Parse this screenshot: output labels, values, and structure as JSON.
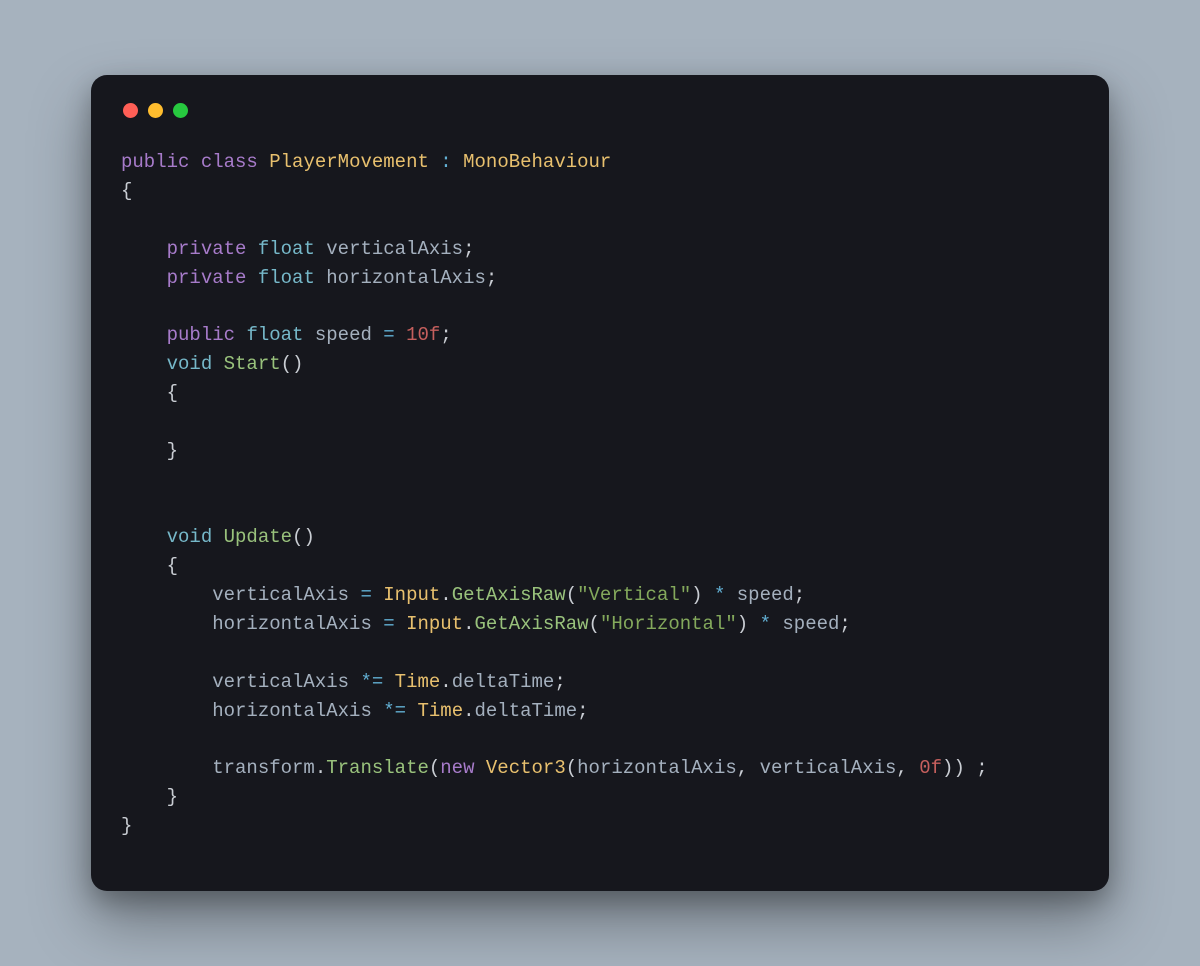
{
  "window": {
    "buttons": [
      "close",
      "minimize",
      "zoom"
    ]
  },
  "code": {
    "lines": [
      [
        {
          "cls": "tok-kw",
          "t": "public"
        },
        {
          "cls": "tok-punc",
          "t": " "
        },
        {
          "cls": "tok-kw",
          "t": "class"
        },
        {
          "cls": "tok-punc",
          "t": " "
        },
        {
          "cls": "tok-class",
          "t": "PlayerMovement"
        },
        {
          "cls": "tok-punc",
          "t": " "
        },
        {
          "cls": "tok-op",
          "t": ":"
        },
        {
          "cls": "tok-punc",
          "t": " "
        },
        {
          "cls": "tok-class",
          "t": "MonoBehaviour"
        }
      ],
      [
        {
          "cls": "tok-punc",
          "t": "{"
        }
      ],
      [
        {
          "cls": "tok-punc",
          "t": ""
        }
      ],
      [
        {
          "cls": "tok-punc",
          "t": "    "
        },
        {
          "cls": "tok-kw",
          "t": "private"
        },
        {
          "cls": "tok-punc",
          "t": " "
        },
        {
          "cls": "tok-type",
          "t": "float"
        },
        {
          "cls": "tok-punc",
          "t": " "
        },
        {
          "cls": "tok-field",
          "t": "verticalAxis"
        },
        {
          "cls": "tok-punc",
          "t": ";"
        }
      ],
      [
        {
          "cls": "tok-punc",
          "t": "    "
        },
        {
          "cls": "tok-kw",
          "t": "private"
        },
        {
          "cls": "tok-punc",
          "t": " "
        },
        {
          "cls": "tok-type",
          "t": "float"
        },
        {
          "cls": "tok-punc",
          "t": " "
        },
        {
          "cls": "tok-field",
          "t": "horizontalAxis"
        },
        {
          "cls": "tok-punc",
          "t": ";"
        }
      ],
      [
        {
          "cls": "tok-punc",
          "t": ""
        }
      ],
      [
        {
          "cls": "tok-punc",
          "t": "    "
        },
        {
          "cls": "tok-kw",
          "t": "public"
        },
        {
          "cls": "tok-punc",
          "t": " "
        },
        {
          "cls": "tok-type",
          "t": "float"
        },
        {
          "cls": "tok-punc",
          "t": " "
        },
        {
          "cls": "tok-field",
          "t": "speed"
        },
        {
          "cls": "tok-punc",
          "t": " "
        },
        {
          "cls": "tok-op",
          "t": "="
        },
        {
          "cls": "tok-punc",
          "t": " "
        },
        {
          "cls": "tok-num",
          "t": "10f"
        },
        {
          "cls": "tok-punc",
          "t": ";"
        }
      ],
      [
        {
          "cls": "tok-punc",
          "t": "    "
        },
        {
          "cls": "tok-type",
          "t": "void"
        },
        {
          "cls": "tok-punc",
          "t": " "
        },
        {
          "cls": "tok-func",
          "t": "Start"
        },
        {
          "cls": "tok-punc",
          "t": "()"
        }
      ],
      [
        {
          "cls": "tok-punc",
          "t": "    {"
        }
      ],
      [
        {
          "cls": "tok-punc",
          "t": ""
        }
      ],
      [
        {
          "cls": "tok-punc",
          "t": "    }"
        }
      ],
      [
        {
          "cls": "tok-punc",
          "t": ""
        }
      ],
      [
        {
          "cls": "tok-punc",
          "t": ""
        }
      ],
      [
        {
          "cls": "tok-punc",
          "t": "    "
        },
        {
          "cls": "tok-type",
          "t": "void"
        },
        {
          "cls": "tok-punc",
          "t": " "
        },
        {
          "cls": "tok-func",
          "t": "Update"
        },
        {
          "cls": "tok-punc",
          "t": "()"
        }
      ],
      [
        {
          "cls": "tok-punc",
          "t": "    {"
        }
      ],
      [
        {
          "cls": "tok-punc",
          "t": "        "
        },
        {
          "cls": "tok-field",
          "t": "verticalAxis"
        },
        {
          "cls": "tok-punc",
          "t": " "
        },
        {
          "cls": "tok-op",
          "t": "="
        },
        {
          "cls": "tok-punc",
          "t": " "
        },
        {
          "cls": "tok-class",
          "t": "Input"
        },
        {
          "cls": "tok-punc",
          "t": "."
        },
        {
          "cls": "tok-func",
          "t": "GetAxisRaw"
        },
        {
          "cls": "tok-punc",
          "t": "("
        },
        {
          "cls": "tok-str",
          "t": "\"Vertical\""
        },
        {
          "cls": "tok-punc",
          "t": ") "
        },
        {
          "cls": "tok-op",
          "t": "*"
        },
        {
          "cls": "tok-punc",
          "t": " "
        },
        {
          "cls": "tok-field",
          "t": "speed"
        },
        {
          "cls": "tok-punc",
          "t": ";"
        }
      ],
      [
        {
          "cls": "tok-punc",
          "t": "        "
        },
        {
          "cls": "tok-field",
          "t": "horizontalAxis"
        },
        {
          "cls": "tok-punc",
          "t": " "
        },
        {
          "cls": "tok-op",
          "t": "="
        },
        {
          "cls": "tok-punc",
          "t": " "
        },
        {
          "cls": "tok-class",
          "t": "Input"
        },
        {
          "cls": "tok-punc",
          "t": "."
        },
        {
          "cls": "tok-func",
          "t": "GetAxisRaw"
        },
        {
          "cls": "tok-punc",
          "t": "("
        },
        {
          "cls": "tok-str",
          "t": "\"Horizontal\""
        },
        {
          "cls": "tok-punc",
          "t": ") "
        },
        {
          "cls": "tok-op",
          "t": "*"
        },
        {
          "cls": "tok-punc",
          "t": " "
        },
        {
          "cls": "tok-field",
          "t": "speed"
        },
        {
          "cls": "tok-punc",
          "t": ";"
        }
      ],
      [
        {
          "cls": "tok-punc",
          "t": ""
        }
      ],
      [
        {
          "cls": "tok-punc",
          "t": "        "
        },
        {
          "cls": "tok-field",
          "t": "verticalAxis"
        },
        {
          "cls": "tok-punc",
          "t": " "
        },
        {
          "cls": "tok-op",
          "t": "*="
        },
        {
          "cls": "tok-punc",
          "t": " "
        },
        {
          "cls": "tok-class",
          "t": "Time"
        },
        {
          "cls": "tok-punc",
          "t": "."
        },
        {
          "cls": "tok-prop",
          "t": "deltaTime"
        },
        {
          "cls": "tok-punc",
          "t": ";"
        }
      ],
      [
        {
          "cls": "tok-punc",
          "t": "        "
        },
        {
          "cls": "tok-field",
          "t": "horizontalAxis"
        },
        {
          "cls": "tok-punc",
          "t": " "
        },
        {
          "cls": "tok-op",
          "t": "*="
        },
        {
          "cls": "tok-punc",
          "t": " "
        },
        {
          "cls": "tok-class",
          "t": "Time"
        },
        {
          "cls": "tok-punc",
          "t": "."
        },
        {
          "cls": "tok-prop",
          "t": "deltaTime"
        },
        {
          "cls": "tok-punc",
          "t": ";"
        }
      ],
      [
        {
          "cls": "tok-punc",
          "t": ""
        }
      ],
      [
        {
          "cls": "tok-punc",
          "t": "        "
        },
        {
          "cls": "tok-prop",
          "t": "transform"
        },
        {
          "cls": "tok-punc",
          "t": "."
        },
        {
          "cls": "tok-func",
          "t": "Translate"
        },
        {
          "cls": "tok-punc",
          "t": "("
        },
        {
          "cls": "tok-kw",
          "t": "new"
        },
        {
          "cls": "tok-punc",
          "t": " "
        },
        {
          "cls": "tok-class",
          "t": "Vector3"
        },
        {
          "cls": "tok-punc",
          "t": "("
        },
        {
          "cls": "tok-field",
          "t": "horizontalAxis"
        },
        {
          "cls": "tok-punc",
          "t": ", "
        },
        {
          "cls": "tok-field",
          "t": "verticalAxis"
        },
        {
          "cls": "tok-punc",
          "t": ", "
        },
        {
          "cls": "tok-num",
          "t": "0f"
        },
        {
          "cls": "tok-punc",
          "t": ")) ;"
        }
      ],
      [
        {
          "cls": "tok-punc",
          "t": "    }"
        }
      ],
      [
        {
          "cls": "tok-punc",
          "t": "}"
        }
      ]
    ]
  }
}
